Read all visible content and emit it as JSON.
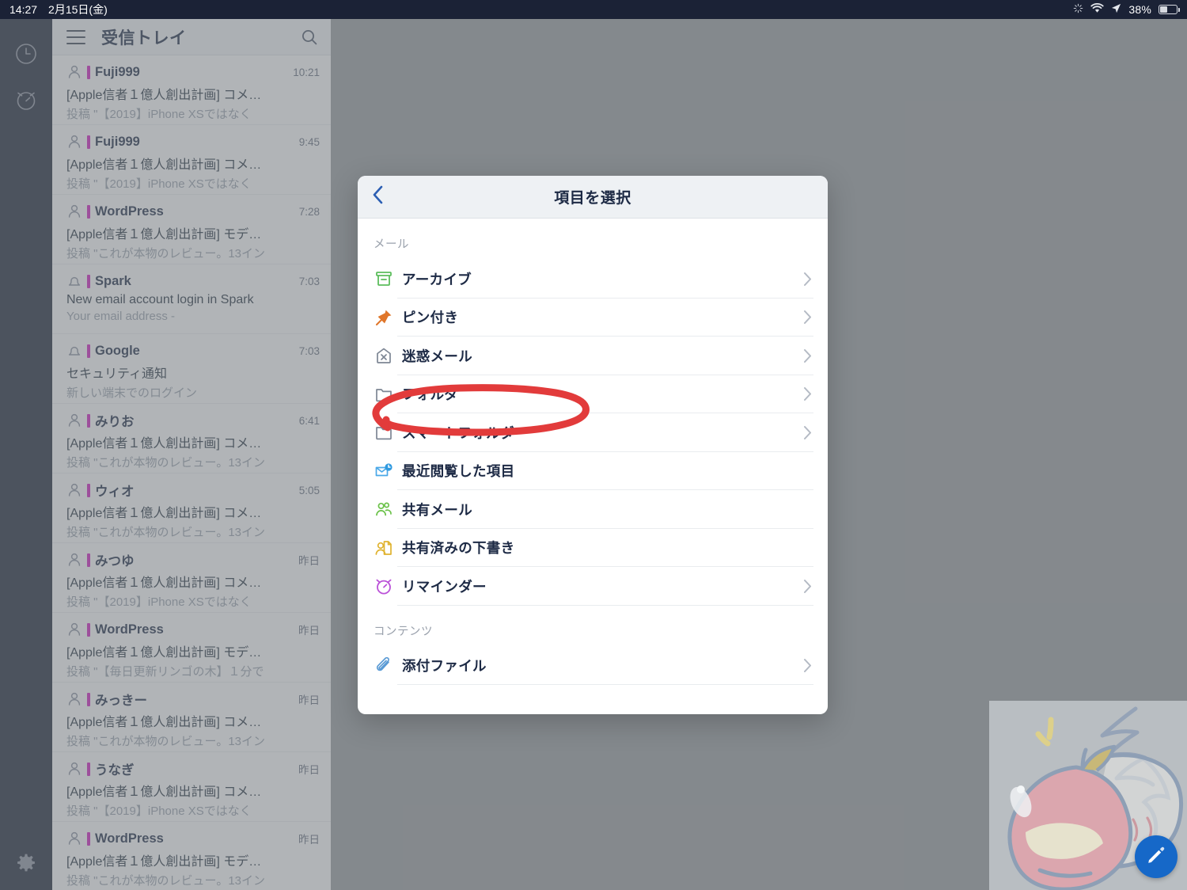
{
  "statusbar": {
    "time": "14:27",
    "date": "2月15日(金)",
    "battery_percent": "38%",
    "icons": [
      "bluetooth-activity-icon",
      "wifi-icon",
      "location-arrow-icon",
      "battery-icon"
    ]
  },
  "rail": {
    "items": [
      {
        "name": "clock-icon",
        "label": ""
      },
      {
        "name": "alarm-clock-icon",
        "label": ""
      }
    ],
    "settings": {
      "name": "gear-icon",
      "label": ""
    }
  },
  "list_pane": {
    "menu_icon": "hamburger-icon",
    "title": "受信トレイ",
    "search_icon": "search-icon",
    "emails": [
      {
        "icon": "person-icon",
        "sender": "Fuji999",
        "time": "10:21",
        "subject": "[Apple信者１億人創出計画] コメ…",
        "preview": "投稿 \"【2019】iPhone XSではなく",
        "unread": true
      },
      {
        "icon": "person-icon",
        "sender": "Fuji999",
        "time": "9:45",
        "subject": "[Apple信者１億人創出計画] コメ…",
        "preview": "投稿 \"【2019】iPhone XSではなく",
        "unread": true
      },
      {
        "icon": "person-icon",
        "sender": "WordPress",
        "time": "7:28",
        "subject": "[Apple信者１億人創出計画] モデ…",
        "preview": "投稿 \"これが本物のレビュー。13イン",
        "unread": true
      },
      {
        "icon": "bell-icon",
        "sender": "Spark",
        "time": "7:03",
        "subject": "New email account login in Spark",
        "preview": "Your email address -",
        "unread": true
      },
      {
        "icon": "bell-icon",
        "sender": "Google",
        "time": "7:03",
        "subject": "セキュリティ通知",
        "preview": "新しい端末でのログイン",
        "unread": true
      },
      {
        "icon": "person-icon",
        "sender": "みりお",
        "time": "6:41",
        "subject": "[Apple信者１億人創出計画] コメ…",
        "preview": "投稿 \"これが本物のレビュー。13イン",
        "unread": true
      },
      {
        "icon": "person-icon",
        "sender": "ウィオ",
        "time": "5:05",
        "subject": "[Apple信者１億人創出計画] コメ…",
        "preview": "投稿 \"これが本物のレビュー。13イン",
        "unread": true
      },
      {
        "icon": "person-icon",
        "sender": "みつゆ",
        "time": "昨日",
        "subject": "[Apple信者１億人創出計画] コメ…",
        "preview": "投稿 \"【2019】iPhone XSではなく",
        "unread": true
      },
      {
        "icon": "person-icon",
        "sender": "WordPress",
        "time": "昨日",
        "subject": "[Apple信者１億人創出計画] モデ…",
        "preview": "投稿 \"【毎日更新リンゴの木】１分で",
        "unread": true
      },
      {
        "icon": "person-icon",
        "sender": "みっきー",
        "time": "昨日",
        "subject": "[Apple信者１億人創出計画] コメ…",
        "preview": "投稿 \"これが本物のレビュー。13イン",
        "unread": true
      },
      {
        "icon": "person-icon",
        "sender": "うなぎ",
        "time": "昨日",
        "subject": "[Apple信者１億人創出計画] コメ…",
        "preview": "投稿 \"【2019】iPhone XSではなく",
        "unread": true
      },
      {
        "icon": "person-icon",
        "sender": "WordPress",
        "time": "昨日",
        "subject": "[Apple信者１億人創出計画] モデ…",
        "preview": "投稿 \"これが本物のレビュー。13イン",
        "unread": true
      }
    ]
  },
  "dialog": {
    "back_icon": "back-chevron-icon",
    "title": "項目を選択",
    "sections": [
      {
        "label": "メール",
        "items": [
          {
            "icon": "archive-box-icon",
            "label": "アーカイブ",
            "chevron": true,
            "color": "#5cbd5c"
          },
          {
            "icon": "pushpin-icon",
            "label": "ピン付き",
            "chevron": true,
            "color": "#e0762a"
          },
          {
            "icon": "spam-envelope-x-icon",
            "label": "迷惑メール",
            "chevron": true,
            "color": "#7d8694"
          },
          {
            "icon": "folder-icon",
            "label": "フォルダ",
            "chevron": true,
            "color": "#7d8694"
          },
          {
            "icon": "smart-folder-icon",
            "label": "スマートフォルダ",
            "chevron": true,
            "color": "#7d8694",
            "annotated": true
          },
          {
            "icon": "recent-mail-clock-icon",
            "label": "最近閲覧した項目",
            "chevron": false,
            "color": "#4aa8e8"
          },
          {
            "icon": "shared-people-icon",
            "label": "共有メール",
            "chevron": false,
            "color": "#6cc24a"
          },
          {
            "icon": "shared-draft-icon",
            "label": "共有済みの下書き",
            "chevron": false,
            "color": "#e0b330"
          },
          {
            "icon": "alarm-clock-icon",
            "label": "リマインダー",
            "chevron": true,
            "color": "#bb52d8"
          }
        ]
      },
      {
        "label": "コンテンツ",
        "items": [
          {
            "icon": "paperclip-icon",
            "label": "添付ファイル",
            "chevron": true,
            "color": "#5b9bd5"
          }
        ]
      }
    ]
  },
  "annotation": {
    "shape": "red-ellipse-highlight",
    "target": "スマートフォルダ",
    "color": "#e23b3b"
  },
  "sketch_overlay": {
    "name": "apple-sketch-thumbnail",
    "fab_icon": "pencil-edit-icon",
    "fab_color": "#1668c8"
  }
}
